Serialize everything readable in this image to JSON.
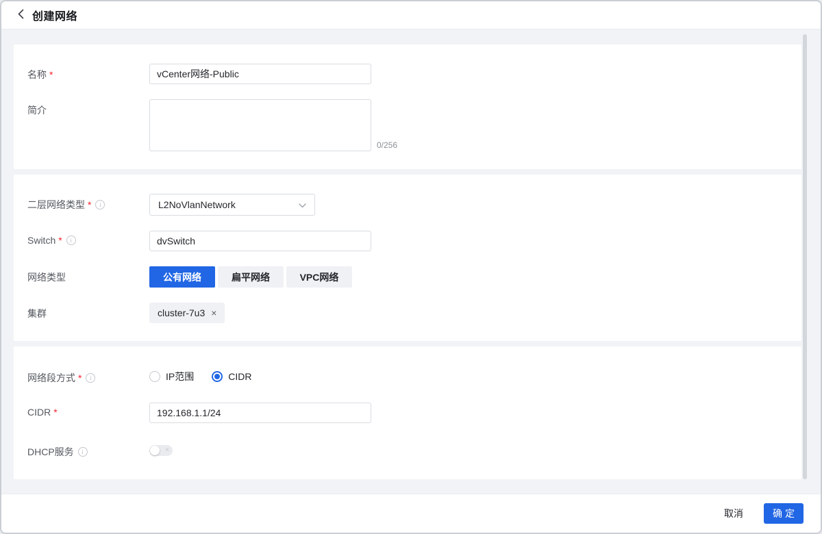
{
  "window": {
    "title": "创建网络"
  },
  "colors": {
    "primary": "#2166e4",
    "required_mark": "#f5222d",
    "page_bg": "#f2f3f6",
    "card_bg": "#ffffff",
    "unselected_btn_bg": "#f0f1f4"
  },
  "icons": {
    "back": "chevron-left",
    "info": "i",
    "select_arrow": "chevron-down",
    "tag_remove": "×",
    "toggle_off": "×"
  },
  "fields": {
    "name": {
      "label": "名称",
      "required": "*",
      "value": "vCenter网络-Public"
    },
    "description": {
      "label": "简介",
      "value": "",
      "counter": "0/256"
    },
    "l2_type": {
      "label": "二层网络类型",
      "required": "*",
      "value": "L2NoVlanNetwork"
    },
    "switch": {
      "label": "Switch",
      "required": "*",
      "value": "dvSwitch"
    },
    "network_type": {
      "label": "网络类型",
      "options": [
        {
          "label": "公有网络",
          "selected": true
        },
        {
          "label": "扁平网络",
          "selected": false
        },
        {
          "label": "VPC网络",
          "selected": false
        }
      ]
    },
    "cluster": {
      "label": "集群",
      "tag": "cluster-7u3",
      "remove_icon": "×"
    },
    "segment_mode": {
      "label": "网络段方式",
      "required": "*",
      "options": [
        {
          "label": "IP范围",
          "selected": false
        },
        {
          "label": "CIDR",
          "selected": true
        }
      ]
    },
    "cidr": {
      "label": "CIDR",
      "required": "*",
      "value": "192.168.1.1/24"
    },
    "dhcp": {
      "label": "DHCP服务",
      "enabled": false,
      "off_icon": "×"
    }
  },
  "footer": {
    "cancel": "取消",
    "confirm": "确定"
  }
}
